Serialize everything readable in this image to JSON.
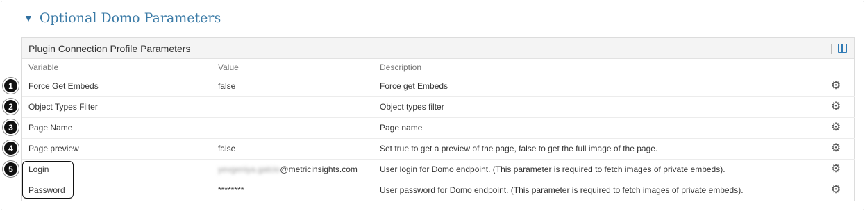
{
  "section": {
    "caret": "▼",
    "title": "Optional Domo Parameters"
  },
  "panel": {
    "title": "Plugin Connection Profile Parameters"
  },
  "columns": {
    "variable": "Variable",
    "value": "Value",
    "description": "Description"
  },
  "rows": [
    {
      "variable": "Force Get Embeds",
      "value": "false",
      "description": "Force get Embeds"
    },
    {
      "variable": "Object Types Filter",
      "value": "",
      "description": "Object types filter"
    },
    {
      "variable": "Page Name",
      "value": "",
      "description": "Page name"
    },
    {
      "variable": "Page preview",
      "value": "false",
      "description": "Set true to get a preview of the page, false to get the full image of the page."
    },
    {
      "variable": "Login",
      "value_redacted": "yevgeniya.gatcio",
      "value": "@metricinsights.com",
      "description": "User login for Domo endpoint. (This parameter is required to fetch images of private embeds)."
    },
    {
      "variable": "Password",
      "value": "********",
      "description": "User password for Domo endpoint. (This parameter is required to fetch images of private embeds)."
    }
  ],
  "badges": [
    "1",
    "2",
    "3",
    "4",
    "5"
  ],
  "icons": {
    "row_action": "gear-icon",
    "toolbar": "columns-icon",
    "section_toggle": "caret-down-icon"
  },
  "colors": {
    "accent": "#3a7aa6",
    "badge": "#111111"
  }
}
